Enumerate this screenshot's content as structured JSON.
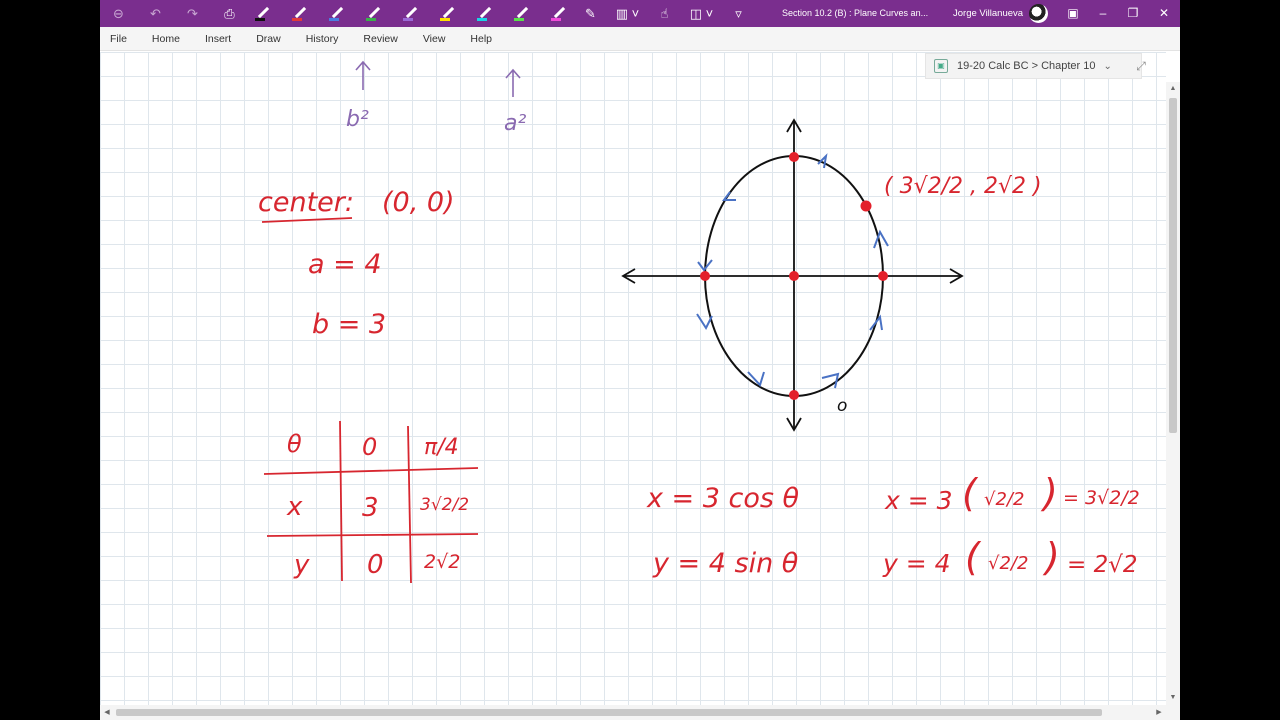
{
  "app": {
    "title": "Section 10.2 (B) : Plane Curves an...",
    "user": "Jorge Villanueva",
    "accent_color": "#7a2e8e",
    "window_controls": [
      "restore-icon",
      "minimize-icon",
      "maximize-icon",
      "close-icon"
    ]
  },
  "toolbar": {
    "icons": [
      "back-icon",
      "undo-icon",
      "redo-icon",
      "print-icon",
      "black-pen-icon",
      "red-pen-icon",
      "blue-pen-icon",
      "green-pen-icon",
      "purple-pen-icon",
      "yellow-highlighter-icon",
      "cyan-highlighter-icon",
      "green-highlighter-icon",
      "pink-highlighter-icon",
      "eraser-icon",
      "more-pens-icon",
      "touch-icon",
      "lasso-icon",
      "customize-icon"
    ]
  },
  "menu": {
    "file": "File",
    "home": "Home",
    "insert": "Insert",
    "draw": "Draw",
    "history": "History",
    "review": "Review",
    "view": "View",
    "help": "Help"
  },
  "breadcrumb": "19-20 Calc BC > Chapter 10",
  "notes": {
    "top_left_label": "b²",
    "top_right_label": "a²",
    "center_label": "center:",
    "center_value": "(0, 0)",
    "a_line": "a = 4",
    "b_line": "b = 3",
    "point_label": "( 3√2/2 , 2√2 )",
    "start_marker": "o",
    "table": {
      "headers": [
        "θ",
        "0",
        "π/4"
      ],
      "rows": [
        [
          "x",
          "3",
          "3√2/2"
        ],
        [
          "y",
          "0",
          "2√2"
        ]
      ]
    },
    "eq_x": "x = 3 cos θ",
    "eq_y": "y = 4 sin θ",
    "calc_x_left": "x = 3",
    "calc_x_frac": "√2/2",
    "calc_x_result": "= 3√2/2",
    "calc_y_left": "y = 4",
    "calc_y_frac": "√2/2",
    "calc_y_result": "= 2√2"
  }
}
